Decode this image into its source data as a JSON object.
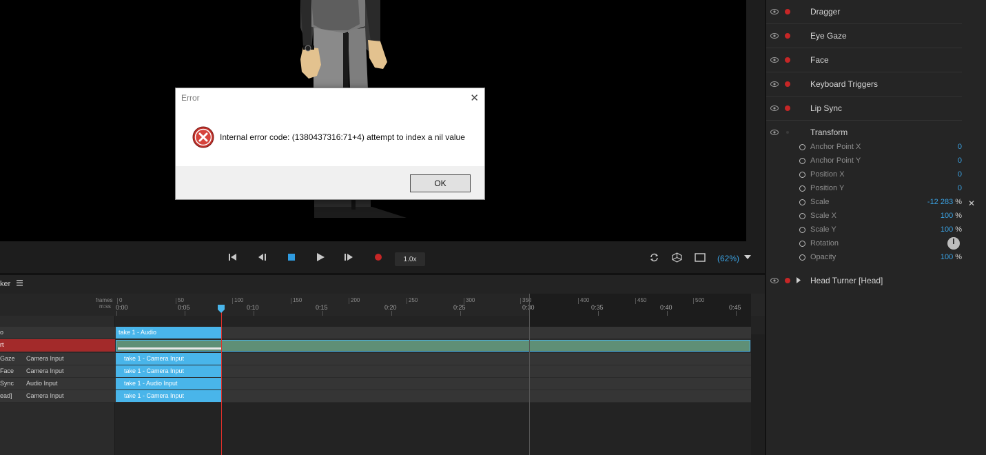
{
  "dialog": {
    "title": "Error",
    "message": "Internal error code: (1380437316:71+4) attempt to index a nil value",
    "ok_label": "OK",
    "close_glyph": "✕"
  },
  "transport": {
    "speed": "1.0x",
    "zoom": "(62%)"
  },
  "timeline": {
    "panel_label": "ker",
    "frames_label": "frames",
    "mss_label": "m:ss",
    "frame_ticks": [
      "0",
      "50",
      "100",
      "150",
      "200",
      "250",
      "300",
      "350",
      "400",
      "450",
      "500"
    ],
    "time_ticks": [
      "0:00",
      "0:05",
      "0:10",
      "0:15",
      "0:20",
      "0:25",
      "0:30",
      "0:35",
      "0:40",
      "0:45"
    ],
    "tracks": [
      {
        "name": "o",
        "input": "",
        "clip": "take 1 - Audio"
      },
      {
        "name": "rt",
        "input": "",
        "clip": ""
      },
      {
        "name": "Gaze",
        "input": "Camera Input",
        "clip": "take 1 - Camera Input"
      },
      {
        "name": "Face",
        "input": "Camera Input",
        "clip": "take 1 - Camera Input"
      },
      {
        "name": "Sync",
        "input": "Audio Input",
        "clip": "take 1 - Audio Input"
      },
      {
        "name": "ead]",
        "input": "Camera Input",
        "clip": "take 1 - Camera Input"
      }
    ]
  },
  "panel": {
    "behaviors": [
      {
        "name": "Dragger"
      },
      {
        "name": "Eye Gaze"
      },
      {
        "name": "Face"
      },
      {
        "name": "Keyboard Triggers"
      },
      {
        "name": "Lip Sync"
      },
      {
        "name": "Transform"
      }
    ],
    "transform_params": [
      {
        "label": "Anchor Point X",
        "value": "0",
        "unit": ""
      },
      {
        "label": "Anchor Point Y",
        "value": "0",
        "unit": ""
      },
      {
        "label": "Position X",
        "value": "0",
        "unit": ""
      },
      {
        "label": "Position Y",
        "value": "0",
        "unit": ""
      },
      {
        "label": "Scale",
        "value": "-12 283",
        "unit": "%"
      },
      {
        "label": "Scale X",
        "value": "100",
        "unit": "%"
      },
      {
        "label": "Scale Y",
        "value": "100",
        "unit": "%"
      },
      {
        "label": "Rotation",
        "value": "",
        "unit": ""
      },
      {
        "label": "Opacity",
        "value": "100",
        "unit": "%"
      }
    ],
    "footer_behavior": "Head Turner [Head]",
    "scale_close_glyph": "✕"
  },
  "icons": {
    "eye": "eye-icon",
    "record": "record-dot-icon",
    "expand": "disclosure-triangle-icon",
    "error": "error-x-icon",
    "hamburger": "hamburger-menu-icon",
    "loop": "loop-icon",
    "camera-toggle": "cube-icon",
    "fullscreen": "square-icon",
    "dropdown": "chevron-down-icon"
  },
  "colors": {
    "accent_blue": "#49b5ea",
    "value_blue": "#3aa0e0",
    "record_red": "#c62626",
    "selected_track_red": "#a32a2a",
    "scene_bg": "#000000"
  }
}
